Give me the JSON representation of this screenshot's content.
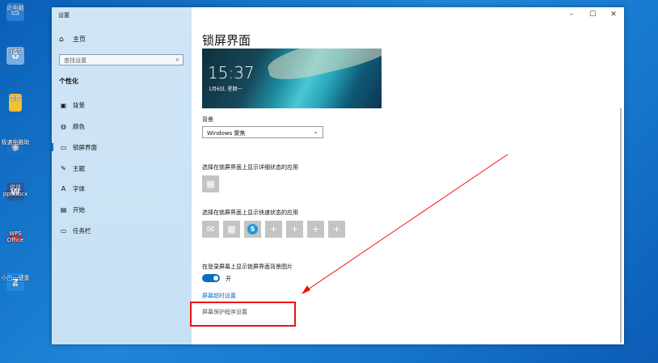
{
  "desktop": {
    "icons": [
      {
        "label": "此电脑",
        "icon": "computer-icon",
        "color": "#2b7fd3"
      },
      {
        "label": "回收站",
        "icon": "recycle-bin-icon",
        "color": "#5a9bd5"
      },
      {
        "label": "文件",
        "icon": "folder-icon",
        "color": "#f1c232"
      },
      {
        "label": "极速电脑助手",
        "icon": "owl-icon",
        "color": "#1b6fc6"
      },
      {
        "label": "说说ppt.docx",
        "icon": "word-doc-icon",
        "color": "#2b579a"
      },
      {
        "label": "WPS Office",
        "icon": "wps-icon",
        "color": "#e0201c"
      },
      {
        "label": "小白一键重装",
        "icon": "app-icon",
        "color": "#1e88e5"
      }
    ]
  },
  "window": {
    "title": "设置",
    "controls": {
      "minimize": "–",
      "maximize": "☐",
      "close": "✕"
    }
  },
  "sidebar": {
    "home": "主页",
    "search_placeholder": "查找设置",
    "section": "个性化",
    "items": [
      {
        "label": "背景",
        "icon": "image-icon",
        "glyph": "▣"
      },
      {
        "label": "颜色",
        "icon": "palette-icon",
        "glyph": "◍"
      },
      {
        "label": "锁屏界面",
        "icon": "lock-screen-icon",
        "glyph": "▭",
        "active": true
      },
      {
        "label": "主题",
        "icon": "theme-icon",
        "glyph": "✎"
      },
      {
        "label": "字体",
        "icon": "font-icon",
        "glyph": "A"
      },
      {
        "label": "开始",
        "icon": "start-icon",
        "glyph": "▤"
      },
      {
        "label": "任务栏",
        "icon": "taskbar-icon",
        "glyph": "▭"
      }
    ]
  },
  "main": {
    "title": "锁屏界面",
    "preview": {
      "time": "15:37",
      "date": "1月6日, 星期一"
    },
    "background_label": "背景",
    "background_value": "Windows 聚焦",
    "detailed_status_label": "选择在锁屏界面上显示详细状态的应用",
    "quick_status_label": "选择在锁屏界面上显示快速状态的应用",
    "show_bg_label": "在登录屏幕上显示锁屏界面背景图片",
    "toggle_state": "开",
    "timeout_link": "屏幕超时设置",
    "screensaver_link": "屏幕保护程序设置"
  },
  "annotation": {
    "highlight_color": "#e11111"
  }
}
